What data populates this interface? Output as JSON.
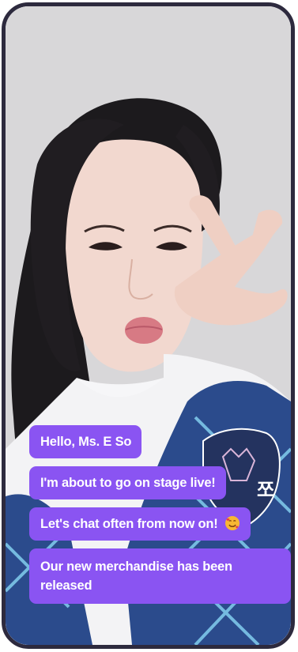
{
  "chat": {
    "messages": [
      {
        "text": "Hello, Ms. E So"
      },
      {
        "text": "I'm about to go on stage live!"
      },
      {
        "text": "Let's chat often from now on!",
        "emoji": "smiling-face-with-hearts-icon"
      },
      {
        "text": "Our new merchandise has been released"
      }
    ]
  },
  "photo": {
    "badge_text": "쪼"
  },
  "colors": {
    "bubble": "#8a54f2",
    "frame": "#2d2a3e",
    "bubble_text": "#ffffff"
  }
}
